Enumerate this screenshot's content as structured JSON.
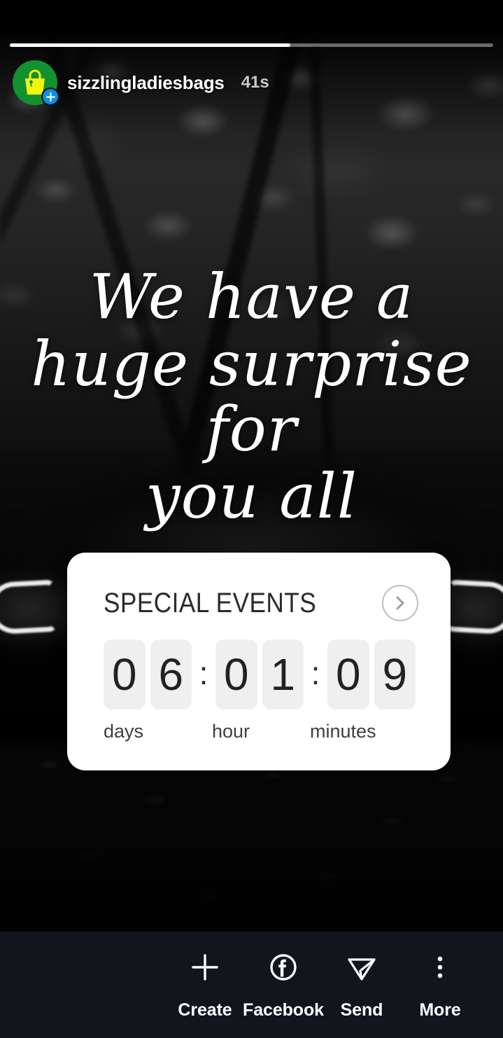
{
  "app": {
    "screen_name": "Instagram Story Viewer"
  },
  "progress": {
    "percent": 58
  },
  "header": {
    "username": "sizzlingladiesbags",
    "timestamp": "41s",
    "avatar_icon": "handbag-icon",
    "avatar_bg_color": "#14912f",
    "avatar_glyph_color": "#f3f50f",
    "add_badge_icon": "plus-icon",
    "add_badge_color": "#0c8df0"
  },
  "story": {
    "headline_lines": [
      "We have a",
      "huge surprise for",
      "you all"
    ],
    "headline_text": "We have a huge surprise for you all"
  },
  "countdown": {
    "title": "SPECIAL EVENTS",
    "next_icon": "chevron-right-icon",
    "digits": [
      "0",
      "6",
      "0",
      "1",
      "0",
      "9"
    ],
    "separator": ":",
    "labels": [
      "days",
      "hour",
      "minutes"
    ],
    "value": "06:01:09",
    "tile_color": "#efefef",
    "card_color": "#ffffff"
  },
  "bottom_bar": {
    "actions": [
      {
        "label": "Create",
        "icon": "plus-icon"
      },
      {
        "label": "Facebook",
        "icon": "facebook-icon"
      },
      {
        "label": "Send",
        "icon": "send-paper-plane-icon"
      },
      {
        "label": "More",
        "icon": "more-vertical-dots-icon"
      }
    ],
    "background_color": "#12151c"
  }
}
